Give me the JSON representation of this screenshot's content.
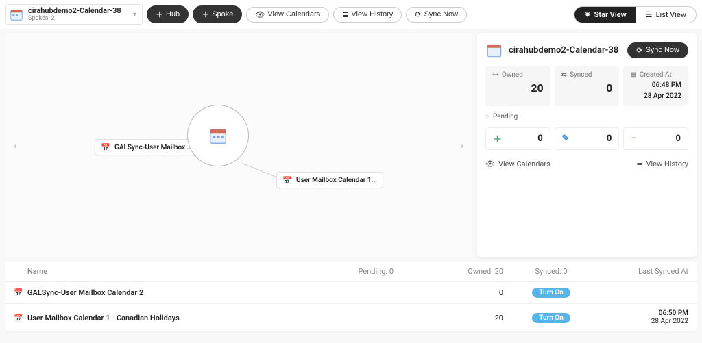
{
  "selector": {
    "title": "cirahubdemo2-Calendar-38",
    "spokes_label": "Spokes: 2"
  },
  "toolbar": {
    "hub": "Hub",
    "spoke": "Spoke",
    "view_calendars": "View Calendars",
    "view_history": "View History",
    "sync_now": "Sync Now"
  },
  "view": {
    "star": "Star View",
    "list": "List View"
  },
  "spokes": [
    {
      "label": "GALSync-User Mailbox ..."
    },
    {
      "label": "User Mailbox Calendar 1..."
    }
  ],
  "details": {
    "name": "cirahubdemo2-Calendar-38",
    "sync_now": "Sync Now",
    "owned_label": "Owned",
    "owned_value": "20",
    "synced_label": "Synced",
    "synced_value": "0",
    "created_label": "Created At",
    "created_time": "06:48 PM",
    "created_date": "28 Apr 2022",
    "pending_label": "Pending",
    "pending_add": "0",
    "pending_edit": "0",
    "pending_remove": "0",
    "link_view_calendars": "View Calendars",
    "link_view_history": "View History"
  },
  "table": {
    "headers": {
      "name": "Name",
      "pending": "Pending: 0",
      "owned": "Owned: 20",
      "synced": "Synced: 0",
      "last": "Last Synced At"
    },
    "rows": [
      {
        "name": "GALSync-User Mailbox Calendar 2",
        "pending": "",
        "owned": "0",
        "synced": "Turn On",
        "last_time": "",
        "last_date": ""
      },
      {
        "name": "User Mailbox Calendar 1 - Canadian Holidays",
        "pending": "",
        "owned": "20",
        "synced": "Turn On",
        "last_time": "06:50 PM",
        "last_date": "28 Apr 2022"
      }
    ]
  }
}
